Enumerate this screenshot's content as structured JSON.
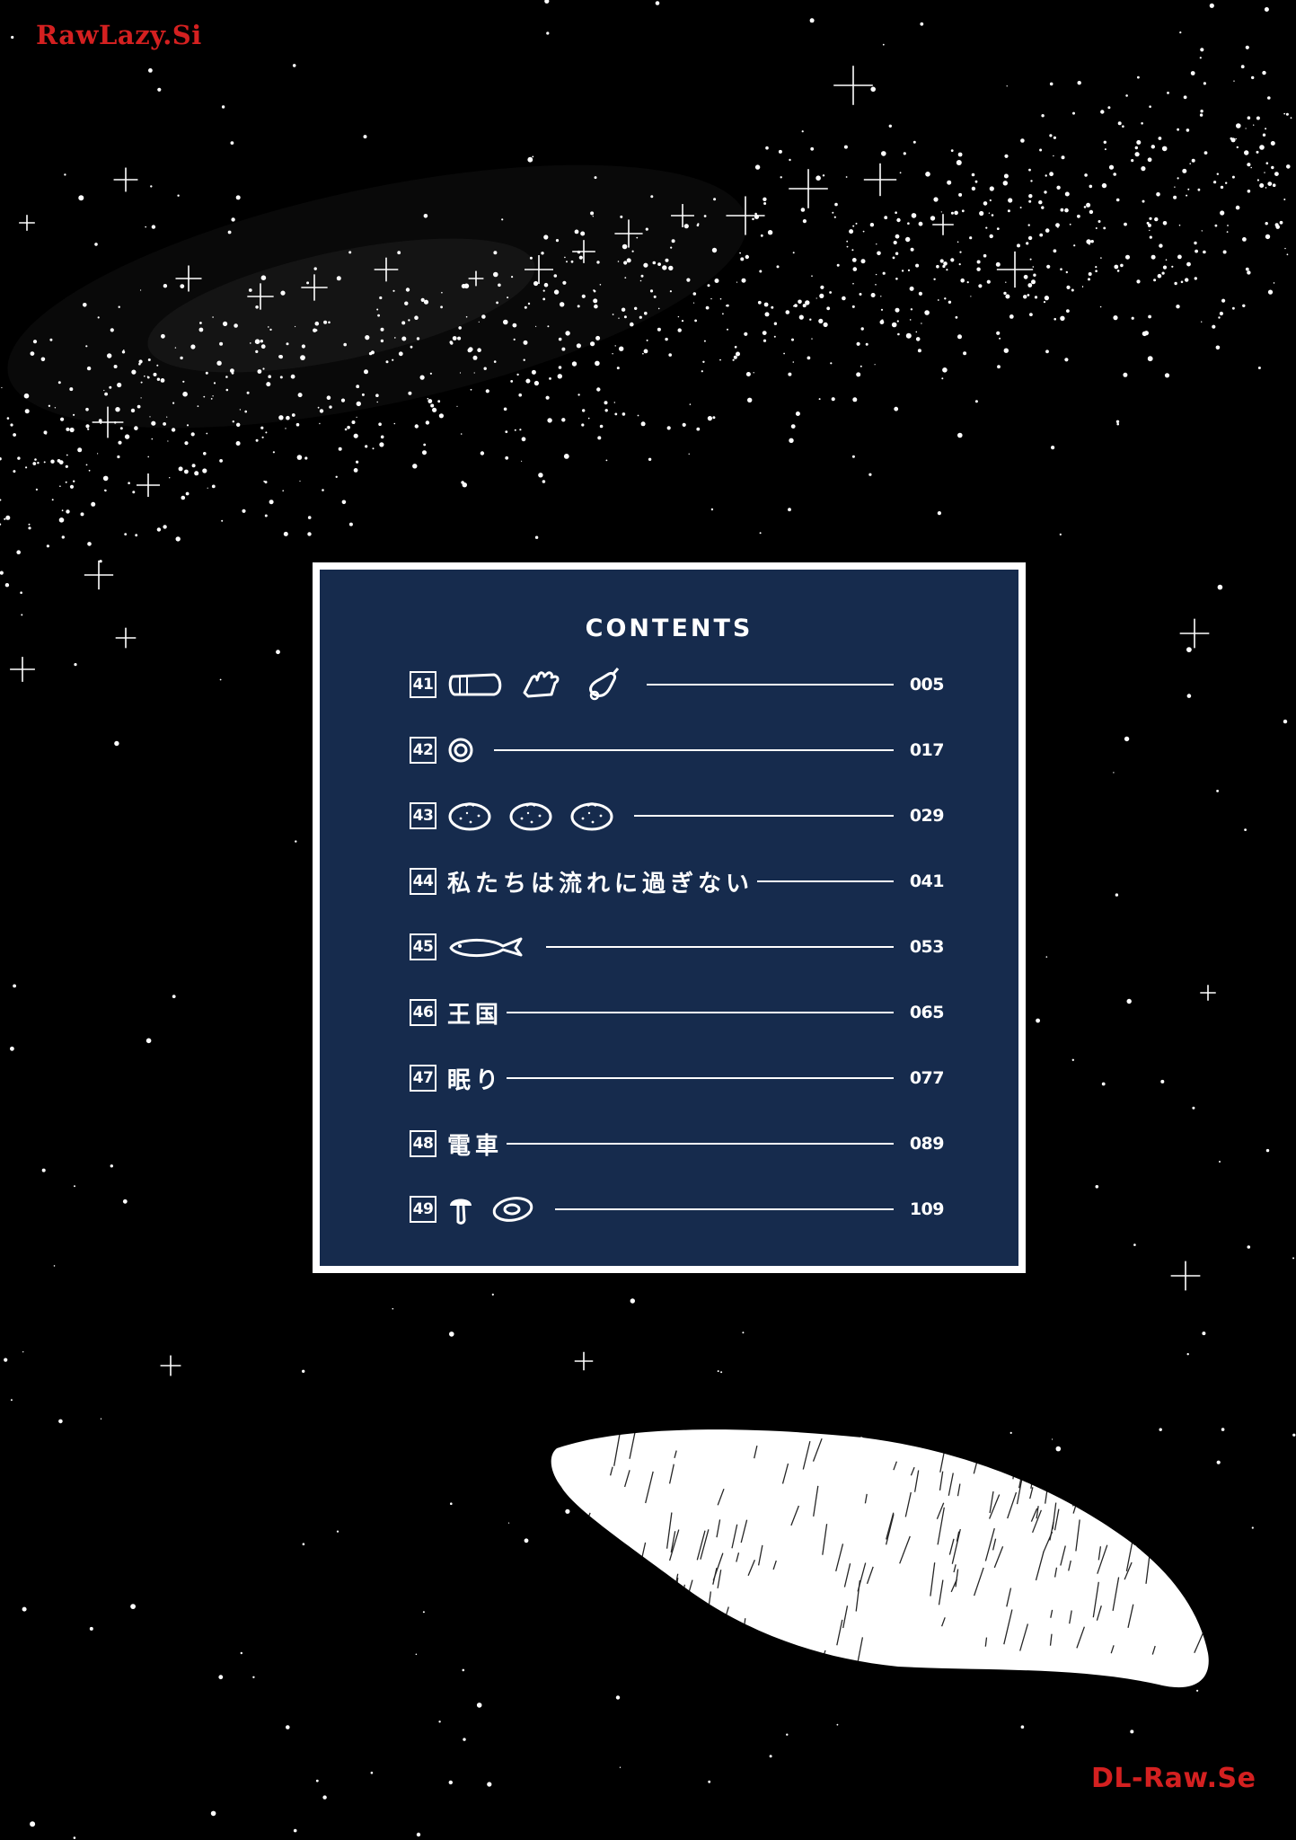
{
  "watermarks": {
    "top_left": "RawLazy.Si",
    "bottom_right": "DL-Raw.Se"
  },
  "toc": {
    "heading": "CONTENTS",
    "entries": [
      {
        "number": "41",
        "title": "",
        "icons": [
          "tube-icon",
          "hand-icon",
          "bell-icon"
        ],
        "page": "005"
      },
      {
        "number": "42",
        "title": "",
        "icons": [
          "double-circle-icon"
        ],
        "page": "017"
      },
      {
        "number": "43",
        "title": "",
        "icons": [
          "tangerine-icon",
          "tangerine-icon",
          "tangerine-icon"
        ],
        "page": "029"
      },
      {
        "number": "44",
        "title": "私たちは流れに過ぎない",
        "icons": [],
        "page": "041"
      },
      {
        "number": "45",
        "title": "",
        "icons": [
          "fish-icon"
        ],
        "page": "053"
      },
      {
        "number": "46",
        "title": "王国",
        "icons": [],
        "page": "065"
      },
      {
        "number": "47",
        "title": "眠り",
        "icons": [],
        "page": "077"
      },
      {
        "number": "48",
        "title": "電車",
        "icons": [],
        "page": "089"
      },
      {
        "number": "49",
        "title": "",
        "icons": [
          "mushroom-icon",
          "egg-icon"
        ],
        "page": "109"
      }
    ]
  },
  "colors": {
    "background": "#000000",
    "panel": "#162b4d",
    "watermark": "#d42020"
  }
}
